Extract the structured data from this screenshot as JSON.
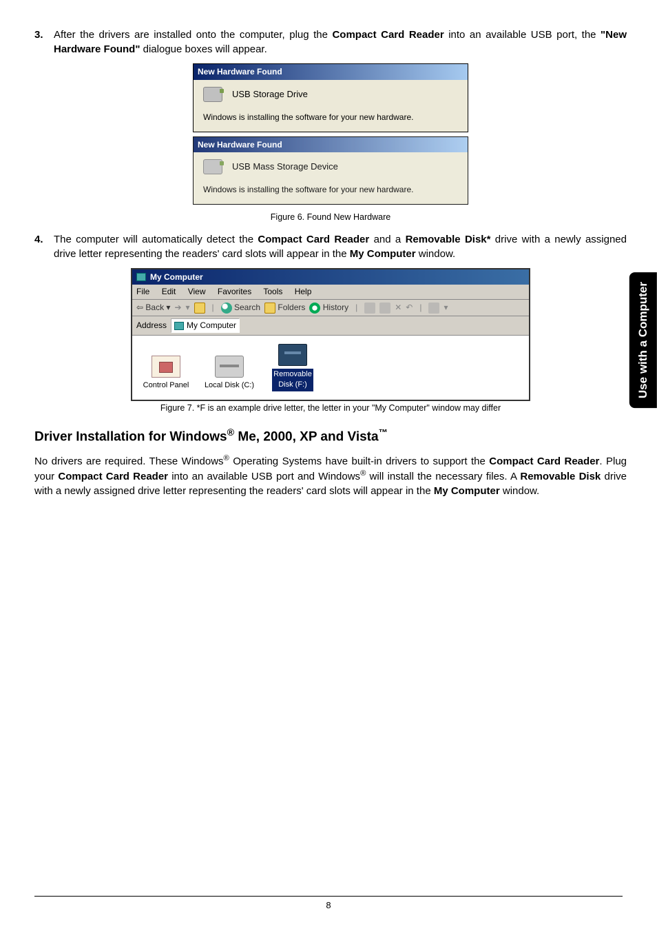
{
  "sideTab": "Use with a Computer",
  "step3": {
    "num": "3.",
    "prefix": "After the drivers are installed onto the computer, plug the ",
    "bold1": "Compact Card Reader",
    "mid": " into an available USB port, the ",
    "bold2": "\"New Hardware Found\"",
    "suffix": " dialogue boxes will appear."
  },
  "dialog1": {
    "title": "New Hardware Found",
    "device": "USB Storage Drive",
    "msg": "Windows is installing the software for your new hardware."
  },
  "dialog2": {
    "title": "New Hardware Found",
    "device": "USB Mass Storage Device",
    "msg": "Windows is installing the software for your new hardware."
  },
  "caption6": "Figure 6. Found New Hardware",
  "step4": {
    "num": "4.",
    "t1": "The computer will automatically detect the ",
    "b1": "Compact Card Reader",
    "t2": " and a ",
    "b2": "Removable Disk*",
    "t3": " drive with a newly assigned drive letter representing the readers' card slots will appear in the ",
    "b3": "My Computer",
    "t4": " window."
  },
  "explorer": {
    "title": "My Computer",
    "menu": {
      "file": "File",
      "edit": "Edit",
      "view": "View",
      "fav": "Favorites",
      "tools": "Tools",
      "help": "Help"
    },
    "toolbar": {
      "back": "Back",
      "search": "Search",
      "folders": "Folders",
      "history": "History"
    },
    "addressLabel": "Address",
    "addressValue": "My Computer",
    "items": {
      "cp": "Control Panel",
      "local": "Local Disk (C:)",
      "rem1": "Removable",
      "rem2": "Disk (F:)"
    }
  },
  "caption7": "Figure 7. *F is an example drive letter, the letter in your \"My Computer\" window may differ",
  "heading": {
    "p1": "Driver Installation for Windows",
    "reg": "®",
    "p2": " Me, 2000, XP and Vista",
    "tm": "™"
  },
  "body": {
    "t1": "No drivers are required. These Windows",
    "r1": "®",
    "t2": " Operating Systems have built-in drivers to support the ",
    "b1": "Compact Card Reader",
    "t3": ". Plug your ",
    "b2": "Compact Card Reader",
    "t4": " into an available USB port and Windows",
    "r2": "®",
    "t5": " will install the necessary files. A ",
    "b3": "Removable Disk",
    "t6": " drive with a newly assigned drive letter representing the readers' card slots will appear in the ",
    "b4": "My Computer",
    "t7": " window."
  },
  "pageNum": "8"
}
